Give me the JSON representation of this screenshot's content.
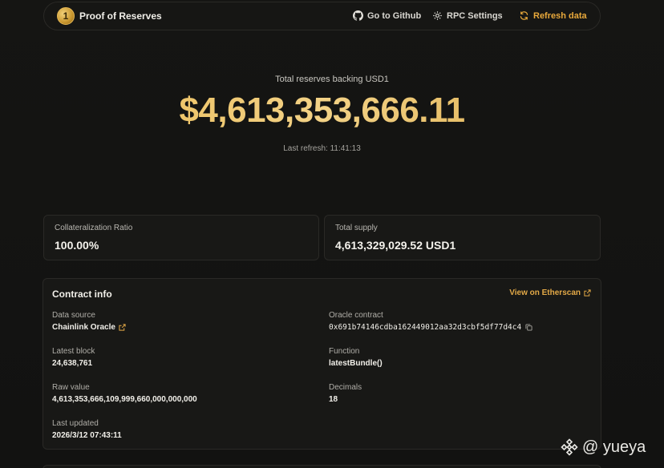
{
  "header": {
    "logo_glyph": "1",
    "brand": "Proof of Reserves",
    "nav": {
      "github": "Go to Github",
      "rpc": "RPC Settings",
      "refresh": "Refresh data"
    }
  },
  "hero": {
    "label": "Total reserves backing USD1",
    "value": "$4,613,353,666.11",
    "last_refresh": "Last refresh: 11:41:13"
  },
  "stats": {
    "collateral": {
      "label": "Collateralization Ratio",
      "value": "100.00%"
    },
    "supply": {
      "label": "Total supply",
      "value": "4,613,329,029.52 USD1"
    }
  },
  "contract": {
    "title": "Contract info",
    "etherscan": "View on Etherscan",
    "data_source": {
      "label": "Data source",
      "value": "Chainlink Oracle"
    },
    "oracle_contract": {
      "label": "Oracle contract",
      "value": "0x691b74146cdba162449012aa32d3cbf5df77d4c4"
    },
    "latest_block": {
      "label": "Latest block",
      "value": "24,638,761"
    },
    "function": {
      "label": "Function",
      "value": "latestBundle()"
    },
    "raw_value": {
      "label": "Raw value",
      "value": "4,613,353,666,109,999,660,000,000,000"
    },
    "decimals": {
      "label": "Decimals",
      "value": "18"
    },
    "last_updated": {
      "label": "Last updated",
      "value": "2026/3/12 07:43:11"
    }
  },
  "watermark": {
    "text": "@ yueya"
  },
  "icons": {
    "github": "github-icon",
    "rpc": "gear-icon",
    "refresh": "refresh-icon",
    "external": "external-link-icon",
    "copy": "copy-icon",
    "watermark": "binance-icon"
  },
  "colors": {
    "accent": "#e9a93b",
    "gold": "#e0b24a",
    "background": "#111110",
    "card": "#181816"
  }
}
